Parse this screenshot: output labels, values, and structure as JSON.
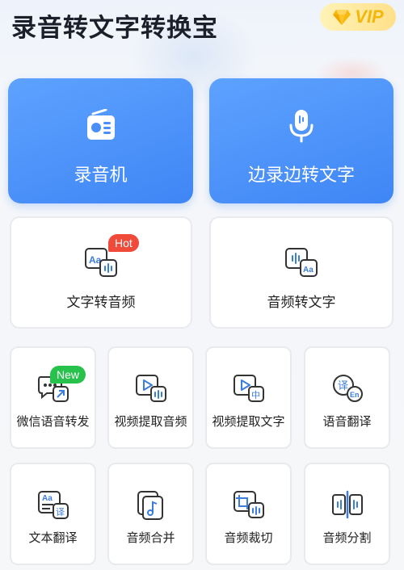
{
  "header": {
    "title": "录音转文字转换宝",
    "vip_label": "VIP",
    "vip_icon": "diamond-icon"
  },
  "colors": {
    "accent": "#4a8ff8",
    "vip_gold": "#f2b70c",
    "hot_tag": "#f04a3b",
    "new_tag": "#27c24c"
  },
  "primary": [
    {
      "label": "录音机",
      "icon": "radio-icon"
    },
    {
      "label": "边录边转文字",
      "icon": "microphone-icon"
    }
  ],
  "secondary": [
    {
      "label": "文字转音频",
      "icon": "text-to-audio-icon",
      "tag": "Hot"
    },
    {
      "label": "音频转文字",
      "icon": "audio-to-text-icon"
    }
  ],
  "tools": [
    {
      "label": "微信语音转发",
      "icon": "wechat-forward-icon",
      "tag": "New"
    },
    {
      "label": "视频提取音频",
      "icon": "video-extract-audio-icon"
    },
    {
      "label": "视频提取文字",
      "icon": "video-extract-text-icon",
      "badge": "中"
    },
    {
      "label": "语音翻译",
      "icon": "voice-translate-icon",
      "glyph": "译",
      "badge": "En"
    },
    {
      "label": "文本翻译",
      "icon": "text-translate-icon",
      "glyph": "Aa",
      "badge": "译"
    },
    {
      "label": "音频合并",
      "icon": "audio-merge-icon"
    },
    {
      "label": "音频裁切",
      "icon": "audio-trim-icon"
    },
    {
      "label": "音频分割",
      "icon": "audio-split-icon"
    }
  ]
}
